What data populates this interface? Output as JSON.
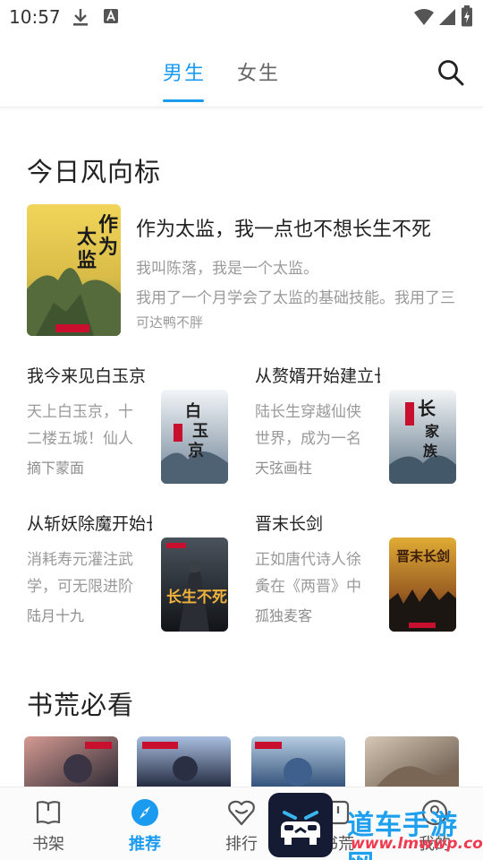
{
  "status_bar": {
    "time": "10:57"
  },
  "top_tabs": [
    {
      "label": "男生",
      "active": true
    },
    {
      "label": "女生",
      "active": false
    }
  ],
  "featured_section": {
    "title": "今日风向标",
    "book": {
      "title": "作为太监，我一点也不想长生不死",
      "desc_line1": "我叫陈落，我是一个太监。",
      "desc_line2": "我用了一个月学会了太监的基础技能。我用了三个月",
      "author": "可达鸭不胖",
      "cover_text": "作为太监",
      "cover_colors": [
        "#f0cf4b",
        "#7f9a57"
      ]
    },
    "grid": [
      {
        "title": "我今来见白玉京",
        "desc": "天上白玉京，十二楼五城！仙人抚我顶",
        "author": "摘下蒙面",
        "cover_text": "白玉京",
        "cover_colors": [
          "#eef2f6",
          "#7a8c9e"
        ]
      },
      {
        "title": "从赘婿开始建立长生家族",
        "desc": "陆长生穿越仙侠世界，成为一名赘婿",
        "author": "天弦画柱",
        "cover_text": "长生家族",
        "cover_colors": [
          "#f1f4f7",
          "#6c8294"
        ]
      },
      {
        "title": "从斩妖除魔开始长生不死",
        "desc": "消耗寿元灌注武学，可无限进阶武学",
        "author": "陆月十九",
        "cover_text": "长生不死",
        "cover_colors": [
          "#3c4550",
          "#15181d"
        ]
      },
      {
        "title": "晋末长剑",
        "desc": "正如唐代诗人徐夤在《两晋》中所言",
        "author": "孤独麦客",
        "cover_text": "晋末长剑",
        "cover_colors": [
          "#d8a12c",
          "#3a2414"
        ]
      }
    ]
  },
  "shelf_section": {
    "title": "书荒必看",
    "covers": [
      {
        "colors": [
          "#c98c8a",
          "#2d2b35"
        ]
      },
      {
        "colors": [
          "#9fb4d6",
          "#1d2438"
        ]
      },
      {
        "colors": [
          "#a8c4dc",
          "#2f4f77"
        ]
      },
      {
        "colors": [
          "#c9b9a8",
          "#6a5847"
        ]
      }
    ]
  },
  "bottom_nav": [
    {
      "label": "书架",
      "icon": "book-icon",
      "active": false
    },
    {
      "label": "推荐",
      "icon": "compass-icon",
      "active": true
    },
    {
      "label": "排行",
      "icon": "heart-chat-icon",
      "active": false
    },
    {
      "label": "书荒",
      "icon": "flag-icon",
      "active": false
    },
    {
      "label": "我的",
      "icon": "user-icon",
      "active": false
    }
  ],
  "watermark": {
    "title": "道车手游网",
    "url": "www.lmwwp.com"
  },
  "colors": {
    "accent": "#1a9bf0",
    "text": "#222222",
    "muted": "#9a9a9a"
  }
}
